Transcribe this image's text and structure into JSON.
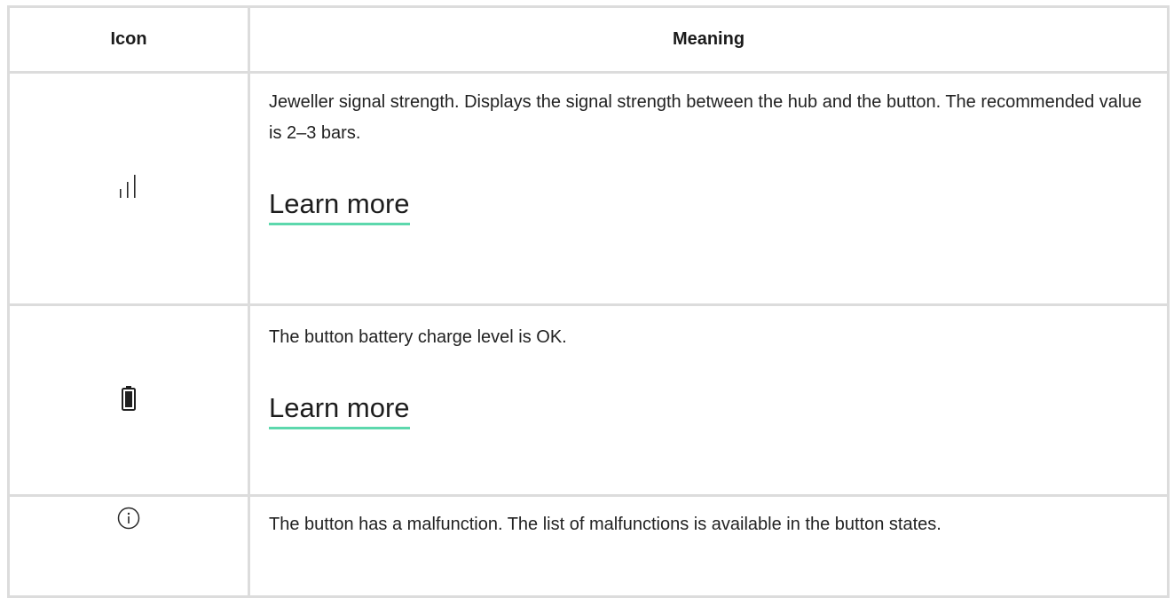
{
  "table": {
    "headers": {
      "icon": "Icon",
      "meaning": "Meaning"
    },
    "rows": [
      {
        "icon": "signal-strength-icon",
        "text": "Jeweller signal strength. Displays the signal strength between the hub and the button. The recommended value is 2–3 bars.",
        "link": "Learn more"
      },
      {
        "icon": "battery-icon",
        "text": "The button battery charge level is OK.",
        "link": "Learn more"
      },
      {
        "icon": "info-icon",
        "text": "The button has a malfunction. The list of malfunctions is available in the button states."
      }
    ]
  },
  "colors": {
    "link_underline": "#5dd8ad",
    "border": "#dcdcdc",
    "text": "#222222"
  }
}
